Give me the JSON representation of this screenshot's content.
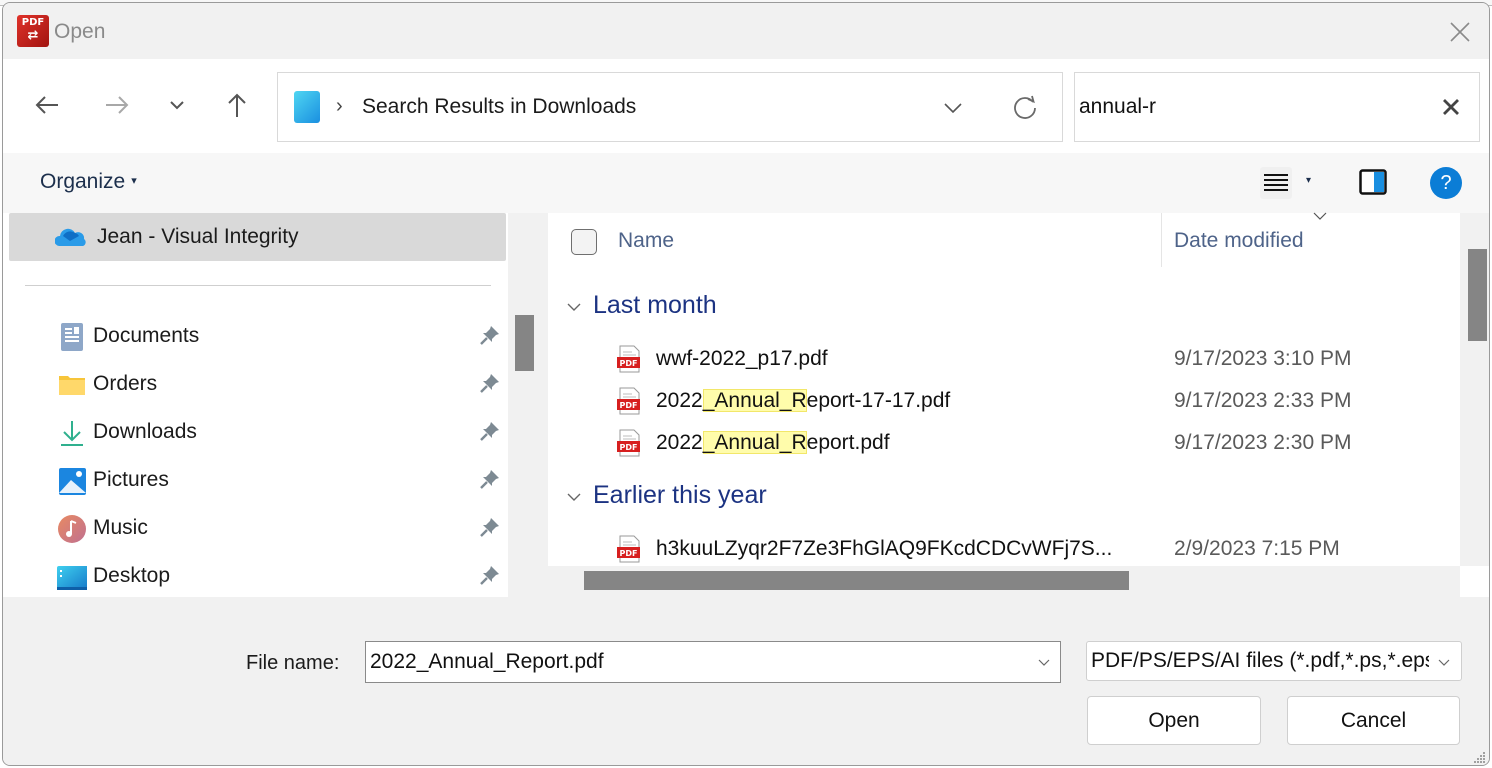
{
  "window": {
    "title": "Open",
    "app_icon_text": "PDF",
    "app_icon_glyph": "⇄"
  },
  "nav": {
    "back_icon": "arrow-left-icon",
    "forward_icon": "arrow-right-icon",
    "recent_icon": "chevron-down-icon",
    "up_icon": "arrow-up-icon"
  },
  "address": {
    "separator": "›",
    "path": "Search Results in Downloads"
  },
  "search": {
    "value": "annual-r",
    "placeholder": ""
  },
  "commandbar": {
    "organize_label": "Organize",
    "organize_caret": "▾",
    "view_dropdown_caret": "▾",
    "help_label": "?"
  },
  "navpane": {
    "onedrive_label": "Jean - Visual Integrity",
    "items": [
      {
        "label": "Documents",
        "icon": "documents-icon",
        "pinned": true
      },
      {
        "label": "Orders",
        "icon": "folder-icon",
        "pinned": true
      },
      {
        "label": "Downloads",
        "icon": "download-icon",
        "pinned": true
      },
      {
        "label": "Pictures",
        "icon": "pictures-icon",
        "pinned": true
      },
      {
        "label": "Music",
        "icon": "music-icon",
        "pinned": true
      },
      {
        "label": "Desktop",
        "icon": "desktop-icon",
        "pinned": true
      }
    ]
  },
  "filelist": {
    "columns": {
      "name": "Name",
      "date": "Date modified"
    },
    "highlight_match": "_Annual_R",
    "groups": [
      {
        "label": "Last month",
        "files": [
          {
            "name_pre": "wwf-2022_p17.pdf",
            "name_hl": "",
            "name_post": "",
            "date": "9/17/2023 3:10 PM"
          },
          {
            "name_pre": "2022",
            "name_hl": "_Annual_R",
            "name_post": "eport-17-17.pdf",
            "date": "9/17/2023 2:33 PM"
          },
          {
            "name_pre": "2022",
            "name_hl": "_Annual_R",
            "name_post": "eport.pdf",
            "date": "9/17/2023 2:30 PM"
          }
        ]
      },
      {
        "label": "Earlier this year",
        "files": [
          {
            "name_pre": "h3kuuLZyqr2F7Ze3FhGlAQ9FKcdCDCvWFj7S...",
            "name_hl": "",
            "name_post": "",
            "date": "2/9/2023 7:15 PM"
          }
        ]
      }
    ]
  },
  "bottom": {
    "filename_label": "File name:",
    "filename_value": "2022_Annual_Report.pdf",
    "filetype_value": "PDF/PS/EPS/AI files (*.pdf,*.ps,*.eps,*.ai)",
    "open_label": "Open",
    "cancel_label": "Cancel"
  },
  "colors": {
    "group_heading": "#1c3382",
    "column_heading": "#4e6389",
    "highlight": "#fffcab",
    "help_accent": "#0b7dd6",
    "scroll_thumb": "#858585",
    "selected_nav": "#d9d9d9"
  }
}
